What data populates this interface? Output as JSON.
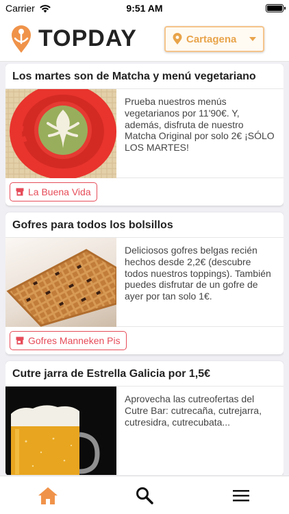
{
  "status_bar": {
    "carrier": "Carrier",
    "time": "9:51 AM"
  },
  "header": {
    "app_name": "TOPDAY",
    "city": "Cartagena"
  },
  "colors": {
    "accent": "#e64b58",
    "brand_orange": "#f0934a",
    "city_border": "#f5c48b"
  },
  "offers": [
    {
      "title": "Los martes son de Matcha y menú vegetariano",
      "description": "Prueba nuestros menús vegetarianos por 11'90€. Y, además, disfruta de nuestro Matcha Original por solo 2€ ¡SÓLO LOS MARTES!",
      "venue": "La Buena Vida",
      "image": "matcha-latte"
    },
    {
      "title": "Gofres para todos los bolsillos",
      "description": "Deliciosos gofres belgas recién hechos desde 2,2€ (descubre todos nuestros toppings). También puedes disfrutar de un gofre de ayer por tan solo 1€.",
      "venue": "Gofres Manneken Pis",
      "image": "waffle"
    },
    {
      "title": "Cutre jarra de Estrella Galicia por 1,5€",
      "description": "Aprovecha las cutreofertas del Cutre Bar: cutrecaña, cutrejarra, cutresidra, cutrecubata...",
      "venue": "",
      "image": "beer-mug"
    }
  ],
  "tab_bar": {
    "icons": [
      "home-icon",
      "search-icon",
      "menu-icon"
    ]
  }
}
